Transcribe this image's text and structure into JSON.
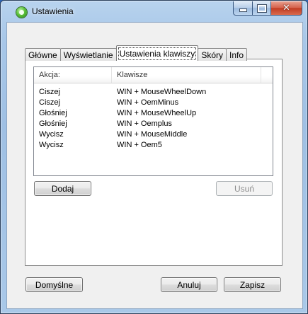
{
  "window": {
    "title": "Ustawienia"
  },
  "tabs": [
    {
      "label": "Główne"
    },
    {
      "label": "Wyświetlanie"
    },
    {
      "label": "Ustawienia klawiszy"
    },
    {
      "label": "Skóry"
    },
    {
      "label": "Info"
    }
  ],
  "active_tab": "Ustawienia klawiszy",
  "shortcut_list": {
    "columns": {
      "action": "Akcja:",
      "keys": "Klawisze"
    },
    "rows": [
      {
        "action": "Ciszej",
        "keys": "WIN + MouseWheelDown"
      },
      {
        "action": "Ciszej",
        "keys": "WIN + OemMinus"
      },
      {
        "action": "Głośniej",
        "keys": "WIN + MouseWheelUp"
      },
      {
        "action": "Głośniej",
        "keys": "WIN + Oemplus"
      },
      {
        "action": "Wycisz",
        "keys": "WIN + MouseMiddle"
      },
      {
        "action": "Wycisz",
        "keys": "WIN + Oem5"
      }
    ]
  },
  "buttons": {
    "add": "Dodaj",
    "remove": "Usuń",
    "defaults": "Domyślne",
    "cancel": "Anuluj",
    "save": "Zapisz"
  },
  "icons": {
    "app": "green-gear-icon",
    "minimize": "minimize-icon",
    "maximize": "maximize-icon",
    "close": "close-icon"
  }
}
